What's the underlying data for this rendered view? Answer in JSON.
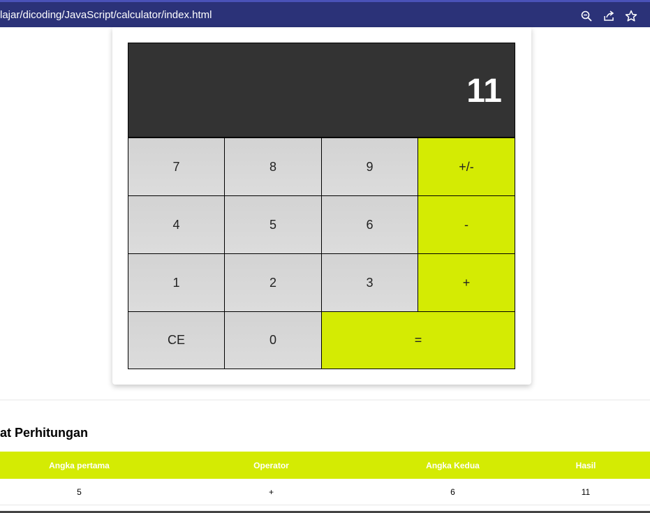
{
  "browser": {
    "url": "lajar/dicoding/JavaScript/calculator/index.html",
    "icons": [
      "zoom-icon",
      "share-icon",
      "star-icon"
    ]
  },
  "calculator": {
    "display": "11",
    "keys": {
      "k7": "7",
      "k8": "8",
      "k9": "9",
      "negate": "+/-",
      "k4": "4",
      "k5": "5",
      "k6": "6",
      "minus": "-",
      "k1": "1",
      "k2": "2",
      "k3": "3",
      "plus": "+",
      "clear": "CE",
      "k0": "0",
      "equals": "="
    },
    "colors": {
      "display_bg": "#333333",
      "operator": "#d4eb03",
      "number": "#d3d3d3"
    }
  },
  "history": {
    "title": "at Perhitungan",
    "headers": [
      "Angka pertama",
      "Operator",
      "Angka Kedua",
      "Hasil"
    ],
    "rows": [
      [
        "5",
        "+",
        "6",
        "11"
      ]
    ]
  }
}
